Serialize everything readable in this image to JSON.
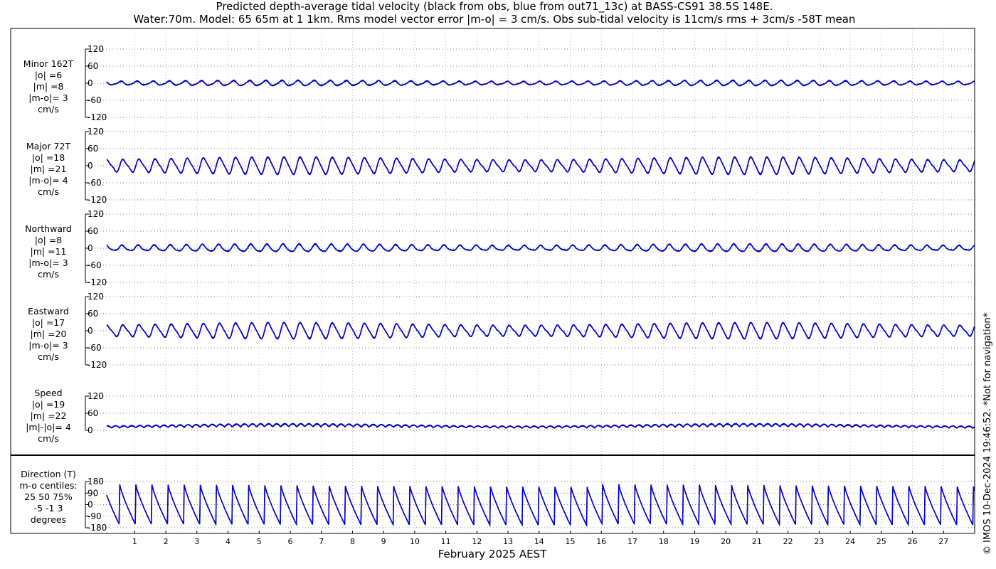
{
  "title": {
    "line1": "Predicted depth-average tidal velocity (black from obs, blue from out71_13c) at BASS-CS91 38.5S 148E.",
    "line2": "Water:70m. Model: 65 65m at 1 1km. Rms model vector error |m-o| = 3 cm/s. Obs sub-tidal velocity is 11cm/s rms + 3cm/s -58T mean"
  },
  "watermark": "© IMOS 10-Dec-2024 19:46:52. *Not for navigation*",
  "colors": {
    "obs": "#000000",
    "model": "#0000ff",
    "grid": "#b4b4b4"
  },
  "chart_data": {
    "type": "line",
    "xlabel": "February 2025 AEST",
    "x_range_days": [
      0.1,
      28.0
    ],
    "x_ticks": [
      "1",
      "2",
      "3",
      "4",
      "5",
      "6",
      "7",
      "8",
      "9",
      "10",
      "11",
      "12",
      "13",
      "14",
      "15",
      "16",
      "17",
      "18",
      "19",
      "20",
      "21",
      "22",
      "23",
      "24",
      "25",
      "26",
      "27"
    ],
    "grid": true,
    "series_legend": {
      "obs": "black from obs",
      "model": "blue from out71_13c"
    },
    "panels": [
      {
        "id": "minor",
        "label_lines": [
          "Minor 162T",
          "|o| =6",
          "|m| =8",
          "|m-o|= 3",
          "cm/s"
        ],
        "ylim": [
          -120,
          120
        ],
        "yticks": [
          "120",
          "60",
          "0",
          "-60",
          "-120"
        ],
        "obs_amplitude": 8,
        "model_amplitude": 10,
        "type": "velocity"
      },
      {
        "id": "major",
        "label_lines": [
          "Major 72T",
          "|o| =18",
          "|m| =21",
          "|m-o|= 4",
          "cm/s"
        ],
        "ylim": [
          -120,
          120
        ],
        "yticks": [
          "120",
          "60",
          "0",
          "-60",
          "-120"
        ],
        "obs_amplitude": 28,
        "model_amplitude": 30,
        "type": "velocity"
      },
      {
        "id": "north",
        "label_lines": [
          "Northward",
          "|o| =8",
          "|m| =11",
          "|m-o|= 3",
          "cm/s"
        ],
        "ylim": [
          -120,
          120
        ],
        "yticks": [
          "120",
          "60",
          "0",
          "-60",
          "-120"
        ],
        "obs_amplitude": 12,
        "model_amplitude": 14,
        "type": "velocity"
      },
      {
        "id": "east",
        "label_lines": [
          "Eastward",
          "|o| =17",
          "|m| =20",
          "|m-o|= 3",
          "cm/s"
        ],
        "ylim": [
          -120,
          120
        ],
        "yticks": [
          "120",
          "60",
          "0",
          "-60",
          "-120"
        ],
        "obs_amplitude": 26,
        "model_amplitude": 28,
        "type": "velocity"
      },
      {
        "id": "speed",
        "label_lines": [
          "Speed",
          "|o| =19",
          "|m| =22",
          "|m|-|o|= 4",
          "cm/s"
        ],
        "ylim": [
          0,
          120
        ],
        "yticks": [
          "120",
          "60",
          "0"
        ],
        "obs_mean": 22,
        "model_mean": 24,
        "type": "speed"
      },
      {
        "id": "direction",
        "label_lines": [
          "Direction (T)",
          "m-o centiles:",
          "25  50  75%",
          "-5  -1   3",
          "degrees"
        ],
        "ylim": [
          -180,
          180
        ],
        "yticks": [
          "180",
          "90",
          "0",
          "-90",
          "-180"
        ],
        "type": "direction"
      }
    ]
  }
}
